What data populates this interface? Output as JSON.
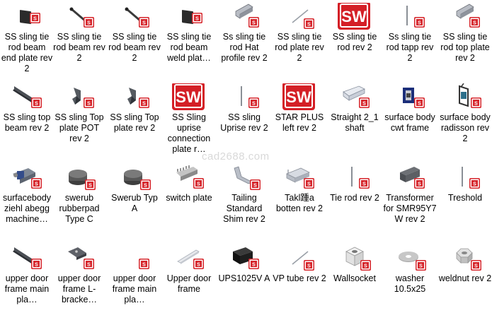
{
  "watermark": "cad2688.com",
  "files": [
    {
      "label": "SS sling tie rod beam end plate rev 2",
      "icon": "sw-part-plate-icon"
    },
    {
      "label": "SS sling tie rod beam rev 2",
      "icon": "sw-part-rod-icon"
    },
    {
      "label": "SS sling tie rod beam rev 2",
      "icon": "sw-part-rod-icon"
    },
    {
      "label": "SS sling tie rod beam weld plat…",
      "icon": "sw-part-plate-icon"
    },
    {
      "label": "Ss sling tie rod Hat profile rev 2",
      "icon": "sw-part-channel-icon"
    },
    {
      "label": "SS sling tie rod plate rev 2",
      "icon": "sw-part-line-icon"
    },
    {
      "label": "SS sling tie rod rev 2",
      "icon": "sw-logo-icon"
    },
    {
      "label": "Ss sling tie rod tapp rev 2",
      "icon": "sw-part-vline-icon"
    },
    {
      "label": "SS sling tie rod top plate rev 2",
      "icon": "sw-part-channel-icon"
    },
    {
      "label": "SS sling top beam rev 2",
      "icon": "sw-part-beam-icon"
    },
    {
      "label": "SS sling Top plate POT rev 2",
      "icon": "sw-part-bracket-icon"
    },
    {
      "label": "SS sling Top plate rev 2",
      "icon": "sw-part-bracket-icon"
    },
    {
      "label": "SS Sling uprise connection plate r…",
      "icon": "sw-logo-icon"
    },
    {
      "label": "SS sling Uprise rev 2",
      "icon": "sw-part-vline-icon"
    },
    {
      "label": "STAR PLUS left rev 2",
      "icon": "sw-logo-icon"
    },
    {
      "label": "Straight 2_1 shaft",
      "icon": "sw-part-shaft-icon"
    },
    {
      "label": "surface body cwt frame",
      "icon": "sw-part-frame-icon"
    },
    {
      "label": "surface body radisson rev 2",
      "icon": "sw-part-radisson-icon"
    },
    {
      "label": "surfacebody ziehl abegg machine…",
      "icon": "sw-part-machine-icon"
    },
    {
      "label": "swerub rubberpad Type C",
      "icon": "sw-part-disc-icon"
    },
    {
      "label": "Swerub Typ A",
      "icon": "sw-part-disc-icon"
    },
    {
      "label": "switch plate",
      "icon": "sw-part-switch-icon"
    },
    {
      "label": "Tailing Standard Shim rev 2",
      "icon": "sw-part-shim-icon"
    },
    {
      "label": "Takl踵a botten rev 2",
      "icon": "sw-part-tray-icon"
    },
    {
      "label": "Tie rod rev 2",
      "icon": "sw-part-vline-icon"
    },
    {
      "label": "Transformer for SMR95Y7 W rev 2",
      "icon": "sw-part-block-icon"
    },
    {
      "label": "Treshold",
      "icon": "sw-part-vline-icon"
    },
    {
      "label": "upper door frame main pla…",
      "icon": "sw-part-beam-icon"
    },
    {
      "label": "upper door frame L-bracke…",
      "icon": "sw-part-lbracket-icon"
    },
    {
      "label": "upper door frame main pla…",
      "icon": "sw-part-blank-icon"
    },
    {
      "label": "Upper door frame",
      "icon": "sw-part-rail-icon"
    },
    {
      "label": "UPS1025V A",
      "icon": "sw-part-ups-icon"
    },
    {
      "label": "VP tube rev 2",
      "icon": "sw-part-line-icon"
    },
    {
      "label": "Wallsocket",
      "icon": "sw-part-socket-icon"
    },
    {
      "label": "washer 10.5x25",
      "icon": "sw-part-washer-icon"
    },
    {
      "label": "weldnut rev 2",
      "icon": "sw-part-nut-icon"
    }
  ]
}
